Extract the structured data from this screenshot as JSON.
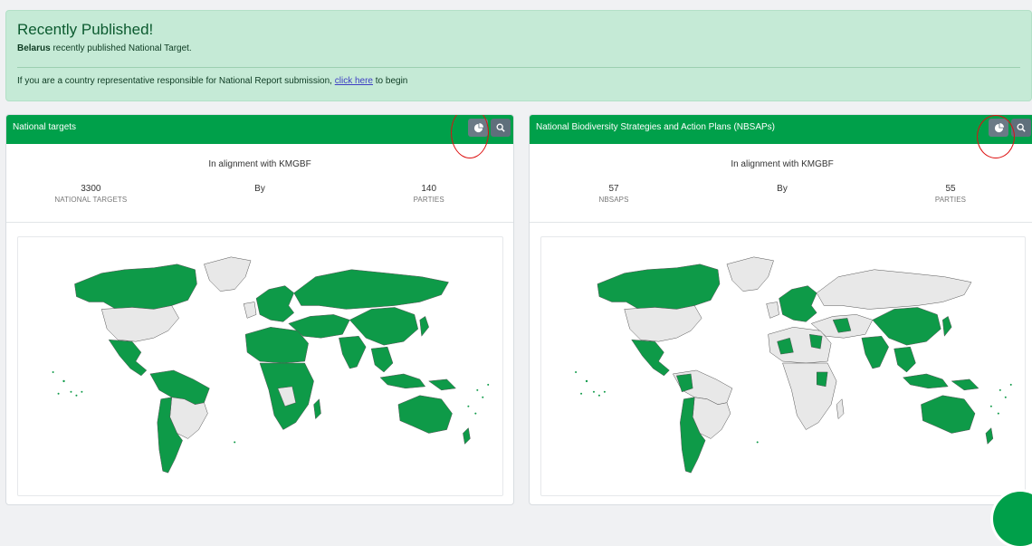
{
  "banner": {
    "title": "Recently Published!",
    "country": "Belarus",
    "message": "recently published National Target.",
    "cta_prefix": "If you are a country representative responsible for National Report submission,",
    "cta_link": "click here",
    "cta_suffix": "to begin"
  },
  "cards": [
    {
      "header": "National targets",
      "subtitle": "In alignment with KMGBF",
      "stat1": {
        "value": "3300",
        "label": "NATIONAL TARGETS"
      },
      "by": "By",
      "stat2": {
        "value": "140",
        "label": "PARTIES"
      }
    },
    {
      "header": "National Biodiversity Strategies and Action Plans (NBSAPs)",
      "subtitle": "In alignment with KMGBF",
      "stat1": {
        "value": "57",
        "label": "NBSAPS"
      },
      "by": "By",
      "stat2": {
        "value": "55",
        "label": "PARTIES"
      }
    }
  ],
  "colors": {
    "accent": "#00a04a",
    "map_highlight": "#0e9a48",
    "map_other": "#e8e8e8",
    "annotation": "#dd1111"
  },
  "icons": {
    "chart": "pie-chart-icon",
    "search": "search-icon"
  }
}
